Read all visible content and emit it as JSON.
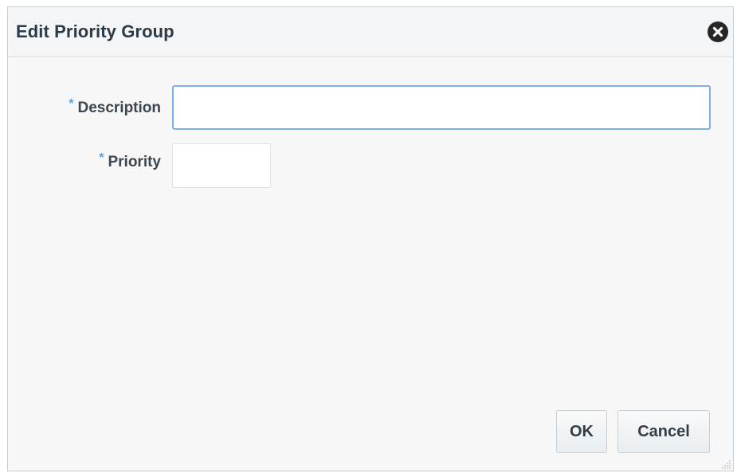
{
  "dialog": {
    "title": "Edit Priority Group",
    "close_icon": "close-circle-icon"
  },
  "form": {
    "description": {
      "required_marker": "*",
      "label": "Description",
      "value": "",
      "placeholder": ""
    },
    "priority": {
      "required_marker": "*",
      "label": "Priority",
      "value": "",
      "placeholder": ""
    }
  },
  "buttons": {
    "ok_label": "OK",
    "cancel_label": "Cancel"
  },
  "colors": {
    "required_marker": "#5a9fd8",
    "focus_border": "#7fb0e3",
    "title_text": "#2b3b47"
  }
}
